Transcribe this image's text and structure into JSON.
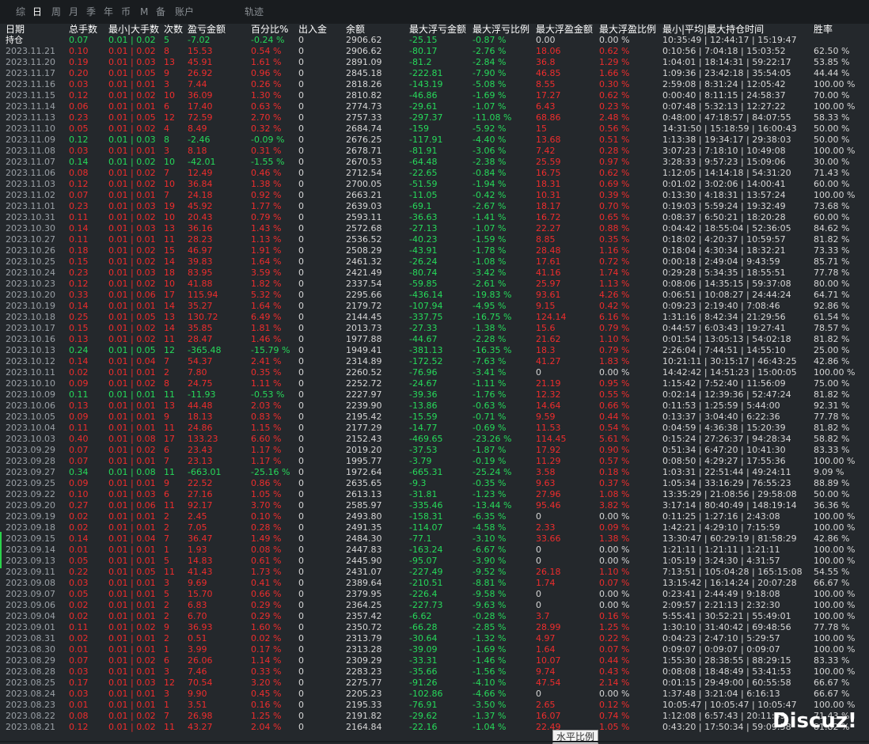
{
  "toolbar": {
    "tabs": [
      "综",
      "日",
      "周",
      "月",
      "季",
      "年",
      "币",
      "M",
      "备",
      "账户",
      "轨迹"
    ],
    "active_tab": "日"
  },
  "table": {
    "headers": [
      "日期",
      "总手数",
      "最小|大手数",
      "次数",
      "盈亏金额",
      "百分比%",
      "出入金",
      "余额",
      "最大浮亏金额",
      "最大浮亏比例",
      "最大浮盈金额",
      "最大浮盈比例",
      "最小|平均|最大持仓时间",
      "胜率"
    ],
    "rows": [
      [
        "持仓",
        "0.07",
        "0.01 | 0.02",
        "5",
        "-7.02",
        "-0.24 %",
        "0",
        "2906.62",
        "-25.15",
        "-0.87 %",
        "0.00",
        "0.00 %",
        "10:35:49 | 12:44:17 | 15:19:47",
        ""
      ],
      [
        "2023.11.21",
        "0.10",
        "0.01 | 0.02",
        "8",
        "15.53",
        "0.54 %",
        "0",
        "2906.62",
        "-80.17",
        "-2.76 %",
        "18.06",
        "0.62 %",
        "0:10:56 | 7:04:18 | 15:03:52",
        "62.50 %"
      ],
      [
        "2023.11.20",
        "0.19",
        "0.01 | 0.03",
        "13",
        "45.91",
        "1.61 %",
        "0",
        "2891.09",
        "-81.2",
        "-2.84 %",
        "36.8",
        "1.29 %",
        "1:04:01 | 18:14:31 | 59:22:17",
        "53.85 %"
      ],
      [
        "2023.11.17",
        "0.20",
        "0.01 | 0.05",
        "9",
        "26.92",
        "0.96 %",
        "0",
        "2845.18",
        "-222.81",
        "-7.90 %",
        "46.85",
        "1.66 %",
        "1:09:36 | 23:42:18 | 35:54:05",
        "44.44 %"
      ],
      [
        "2023.11.16",
        "0.03",
        "0.01 | 0.01",
        "3",
        "7.44",
        "0.26 %",
        "0",
        "2818.26",
        "-143.19",
        "-5.08 %",
        "8.55",
        "0.30 %",
        "2:59:08 | 8:31:24 | 12:05:42",
        "100.00 %"
      ],
      [
        "2023.11.15",
        "0.12",
        "0.01 | 0.02",
        "10",
        "36.09",
        "1.30 %",
        "0",
        "2810.82",
        "-46.86",
        "-1.69 %",
        "17.27",
        "0.62 %",
        "0:00:40 | 8:11:15 | 24:58:37",
        "70.00 %"
      ],
      [
        "2023.11.14",
        "0.06",
        "0.01 | 0.01",
        "6",
        "17.40",
        "0.63 %",
        "0",
        "2774.73",
        "-29.61",
        "-1.07 %",
        "6.43",
        "0.23 %",
        "0:07:48 | 5:32:13 | 12:27:22",
        "100.00 %"
      ],
      [
        "2023.11.13",
        "0.23",
        "0.01 | 0.05",
        "12",
        "72.59",
        "2.70 %",
        "0",
        "2757.33",
        "-297.37",
        "-11.08 %",
        "68.86",
        "2.48 %",
        "0:48:00 | 47:18:57 | 84:07:55",
        "58.33 %"
      ],
      [
        "2023.11.10",
        "0.05",
        "0.01 | 0.02",
        "4",
        "8.49",
        "0.32 %",
        "0",
        "2684.74",
        "-159",
        "-5.92 %",
        "15",
        "0.56 %",
        "14:31:50 | 15:18:59 | 16:00:43",
        "50.00 %"
      ],
      [
        "2023.11.09",
        "0.12",
        "0.01 | 0.03",
        "8",
        "-2.46",
        "-0.09 %",
        "0",
        "2676.25",
        "-117.91",
        "-4.40 %",
        "13.68",
        "0.51 %",
        "1:13:38 | 19:34:17 | 29:38:03",
        "50.00 %"
      ],
      [
        "2023.11.08",
        "0.03",
        "0.01 | 0.01",
        "3",
        "8.18",
        "0.31 %",
        "0",
        "2678.71",
        "-81.91",
        "-3.06 %",
        "7.42",
        "0.28 %",
        "3:07:23 | 7:18:10 | 10:49:08",
        "100.00 %"
      ],
      [
        "2023.11.07",
        "0.14",
        "0.01 | 0.02",
        "10",
        "-42.01",
        "-1.55 %",
        "0",
        "2670.53",
        "-64.48",
        "-2.38 %",
        "25.59",
        "0.97 %",
        "3:28:33 | 9:57:23 | 15:09:06",
        "30.00 %"
      ],
      [
        "2023.11.06",
        "0.08",
        "0.01 | 0.02",
        "7",
        "12.49",
        "0.46 %",
        "0",
        "2712.54",
        "-22.65",
        "-0.84 %",
        "16.75",
        "0.62 %",
        "1:12:05 | 14:14:18 | 54:31:20",
        "71.43 %"
      ],
      [
        "2023.11.03",
        "0.12",
        "0.01 | 0.02",
        "10",
        "36.84",
        "1.38 %",
        "0",
        "2700.05",
        "-51.59",
        "-1.94 %",
        "18.31",
        "0.69 %",
        "0:01:02 | 3:02:06 | 14:00:41",
        "60.00 %"
      ],
      [
        "2023.11.02",
        "0.07",
        "0.01 | 0.01",
        "7",
        "24.18",
        "0.92 %",
        "0",
        "2663.21",
        "-11.05",
        "-0.42 %",
        "10.31",
        "0.39 %",
        "0:13:30 | 4:18:31 | 13:57:24",
        "100.00 %"
      ],
      [
        "2023.11.01",
        "0.23",
        "0.01 | 0.03",
        "19",
        "45.92",
        "1.77 %",
        "0",
        "2639.03",
        "-69.1",
        "-2.67 %",
        "18.17",
        "0.70 %",
        "0:19:03 | 5:59:24 | 19:32:49",
        "73.68 %"
      ],
      [
        "2023.10.31",
        "0.11",
        "0.01 | 0.02",
        "10",
        "20.43",
        "0.79 %",
        "0",
        "2593.11",
        "-36.63",
        "-1.41 %",
        "16.72",
        "0.65 %",
        "0:08:37 | 6:50:21 | 18:20:28",
        "60.00 %"
      ],
      [
        "2023.10.30",
        "0.14",
        "0.01 | 0.03",
        "13",
        "36.16",
        "1.43 %",
        "0",
        "2572.68",
        "-27.13",
        "-1.07 %",
        "22.27",
        "0.88 %",
        "0:04:42 | 18:55:04 | 52:36:05",
        "84.62 %"
      ],
      [
        "2023.10.27",
        "0.11",
        "0.01 | 0.01",
        "11",
        "28.23",
        "1.13 %",
        "0",
        "2536.52",
        "-40.23",
        "-1.59 %",
        "8.85",
        "0.35 %",
        "0:18:02 | 4:20:37 | 10:59:57",
        "81.82 %"
      ],
      [
        "2023.10.26",
        "0.18",
        "0.01 | 0.02",
        "15",
        "46.97",
        "1.91 %",
        "0",
        "2508.29",
        "-43.91",
        "-1.78 %",
        "28.48",
        "1.16 %",
        "0:18:04 | 4:30:34 | 18:32:21",
        "73.33 %"
      ],
      [
        "2023.10.25",
        "0.15",
        "0.01 | 0.02",
        "14",
        "39.83",
        "1.64 %",
        "0",
        "2461.32",
        "-26.24",
        "-1.08 %",
        "17.61",
        "0.72 %",
        "0:00:18 | 2:49:04 | 9:43:59",
        "85.71 %"
      ],
      [
        "2023.10.24",
        "0.23",
        "0.01 | 0.03",
        "18",
        "83.95",
        "3.59 %",
        "0",
        "2421.49",
        "-80.74",
        "-3.42 %",
        "41.16",
        "1.74 %",
        "0:29:28 | 5:34:35 | 18:55:51",
        "77.78 %"
      ],
      [
        "2023.10.23",
        "0.12",
        "0.01 | 0.02",
        "10",
        "41.88",
        "1.82 %",
        "0",
        "2337.54",
        "-59.85",
        "-2.61 %",
        "25.97",
        "1.13 %",
        "0:08:06 | 14:35:15 | 59:37:08",
        "80.00 %"
      ],
      [
        "2023.10.20",
        "0.33",
        "0.01 | 0.06",
        "17",
        "115.94",
        "5.32 %",
        "0",
        "2295.66",
        "-436.14",
        "-19.83 %",
        "93.61",
        "4.26 %",
        "0:06:51 | 10:08:27 | 24:44:24",
        "64.71 %"
      ],
      [
        "2023.10.19",
        "0.14",
        "0.01 | 0.01",
        "14",
        "35.27",
        "1.64 %",
        "0",
        "2179.72",
        "-107.94",
        "-4.95 %",
        "9.15",
        "0.42 %",
        "0:09:23 | 2:19:40 | 7:08:46",
        "92.86 %"
      ],
      [
        "2023.10.18",
        "0.25",
        "0.01 | 0.05",
        "13",
        "130.72",
        "6.49 %",
        "0",
        "2144.45",
        "-337.75",
        "-16.75 %",
        "124.14",
        "6.16 %",
        "1:31:16 | 8:42:34 | 21:29:56",
        "61.54 %"
      ],
      [
        "2023.10.17",
        "0.15",
        "0.01 | 0.02",
        "14",
        "35.85",
        "1.81 %",
        "0",
        "2013.73",
        "-27.33",
        "-1.38 %",
        "15.6",
        "0.79 %",
        "0:44:57 | 6:03:43 | 19:27:41",
        "78.57 %"
      ],
      [
        "2023.10.16",
        "0.13",
        "0.01 | 0.02",
        "11",
        "28.47",
        "1.46 %",
        "0",
        "1977.88",
        "-44.67",
        "-2.28 %",
        "21.62",
        "1.10 %",
        "0:01:54 | 13:05:13 | 54:02:18",
        "81.82 %"
      ],
      [
        "2023.10.13",
        "0.24",
        "0.01 | 0.05",
        "12",
        "-365.48",
        "-15.79 %",
        "0",
        "1949.41",
        "-381.13",
        "-16.35 %",
        "18.3",
        "0.79 %",
        "2:26:04 | 7:44:51 | 14:55:10",
        "25.00 %"
      ],
      [
        "2023.10.12",
        "0.14",
        "0.01 | 0.04",
        "7",
        "54.37",
        "2.41 %",
        "0",
        "2314.89",
        "-172.52",
        "-7.63 %",
        "41.27",
        "1.83 %",
        "10:21:11 | 30:15:17 | 46:43:25",
        "42.86 %"
      ],
      [
        "2023.10.11",
        "0.02",
        "0.01 | 0.01",
        "2",
        "7.80",
        "0.35 %",
        "0",
        "2260.52",
        "-76.96",
        "-3.41 %",
        "0",
        "0.00 %",
        "14:42:42 | 14:51:23 | 15:00:05",
        "100.00 %"
      ],
      [
        "2023.10.10",
        "0.09",
        "0.01 | 0.02",
        "8",
        "24.75",
        "1.11 %",
        "0",
        "2252.72",
        "-24.67",
        "-1.11 %",
        "21.19",
        "0.95 %",
        "1:15:42 | 7:52:40 | 11:56:09",
        "75.00 %"
      ],
      [
        "2023.10.09",
        "0.11",
        "0.01 | 0.01",
        "11",
        "-11.93",
        "-0.53 %",
        "0",
        "2227.97",
        "-39.36",
        "-1.76 %",
        "12.32",
        "0.55 %",
        "0:02:14 | 12:39:36 | 52:47:24",
        "81.82 %"
      ],
      [
        "2023.10.06",
        "0.13",
        "0.01 | 0.01",
        "13",
        "44.48",
        "2.03 %",
        "0",
        "2239.90",
        "-13.86",
        "-0.63 %",
        "14.64",
        "0.66 %",
        "0:11:53 | 1:25:59 | 5:44:00",
        "92.31 %"
      ],
      [
        "2023.10.05",
        "0.09",
        "0.01 | 0.01",
        "9",
        "18.13",
        "0.83 %",
        "0",
        "2195.42",
        "-15.59",
        "-0.71 %",
        "9.59",
        "0.44 %",
        "0:13:37 | 3:04:40 | 6:22:36",
        "77.78 %"
      ],
      [
        "2023.10.04",
        "0.11",
        "0.01 | 0.01",
        "11",
        "24.86",
        "1.15 %",
        "0",
        "2177.29",
        "-14.77",
        "-0.69 %",
        "11.53",
        "0.54 %",
        "0:04:59 | 4:36:38 | 15:20:39",
        "81.82 %"
      ],
      [
        "2023.10.03",
        "0.40",
        "0.01 | 0.08",
        "17",
        "133.23",
        "6.60 %",
        "0",
        "2152.43",
        "-469.65",
        "-23.26 %",
        "114.45",
        "5.61 %",
        "0:15:24 | 27:26:37 | 94:28:34",
        "58.82 %"
      ],
      [
        "2023.09.29",
        "0.07",
        "0.01 | 0.02",
        "6",
        "23.43",
        "1.17 %",
        "0",
        "2019.20",
        "-37.53",
        "-1.87 %",
        "17.92",
        "0.90 %",
        "0:51:34 | 6:47:20 | 10:41:30",
        "83.33 %"
      ],
      [
        "2023.09.28",
        "0.07",
        "0.01 | 0.01",
        "7",
        "23.13",
        "1.17 %",
        "0",
        "1995.77",
        "-3.79",
        "-0.19 %",
        "11.29",
        "0.57 %",
        "0:08:50 | 4:29:27 | 17:55:36",
        "100.00 %"
      ],
      [
        "2023.09.27",
        "0.34",
        "0.01 | 0.08",
        "11",
        "-663.01",
        "-25.16 %",
        "0",
        "1972.64",
        "-665.31",
        "-25.24 %",
        "3.58",
        "0.18 %",
        "1:03:31 | 22:51:44 | 49:24:11",
        "9.09 %"
      ],
      [
        "2023.09.25",
        "0.09",
        "0.01 | 0.01",
        "9",
        "22.52",
        "0.86 %",
        "0",
        "2635.65",
        "-9.3",
        "-0.35 %",
        "9.63",
        "0.37 %",
        "1:05:34 | 33:16:29 | 76:55:23",
        "88.89 %"
      ],
      [
        "2023.09.22",
        "0.10",
        "0.01 | 0.03",
        "6",
        "27.16",
        "1.05 %",
        "0",
        "2613.13",
        "-31.81",
        "-1.23 %",
        "27.96",
        "1.08 %",
        "13:35:29 | 21:08:56 | 29:58:08",
        "50.00 %"
      ],
      [
        "2023.09.20",
        "0.27",
        "0.01 | 0.06",
        "11",
        "92.17",
        "3.70 %",
        "0",
        "2585.97",
        "-335.46",
        "-13.44 %",
        "95.46",
        "3.82 %",
        "3:17:14 | 80:40:49 | 148:19:14",
        "36.36 %"
      ],
      [
        "2023.09.19",
        "0.02",
        "0.01 | 0.01",
        "2",
        "2.45",
        "0.10 %",
        "0",
        "2493.80",
        "-158.31",
        "-6.35 %",
        "0",
        "0.00 %",
        "0:11:25 | 1:27:16 | 2:43:08",
        "100.00 %"
      ],
      [
        "2023.09.18",
        "0.02",
        "0.01 | 0.01",
        "2",
        "7.05",
        "0.28 %",
        "0",
        "2491.35",
        "-114.07",
        "-4.58 %",
        "2.33",
        "0.09 %",
        "1:42:21 | 4:29:10 | 7:15:59",
        "100.00 %"
      ],
      [
        "2023.09.15",
        "0.14",
        "0.01 | 0.04",
        "7",
        "36.47",
        "1.49 %",
        "0",
        "2484.30",
        "-77.1",
        "-3.10 %",
        "33.66",
        "1.38 %",
        "13:30:47 | 60:29:19 | 81:58:29",
        "42.86 %"
      ],
      [
        "2023.09.14",
        "0.01",
        "0.01 | 0.01",
        "1",
        "1.93",
        "0.08 %",
        "0",
        "2447.83",
        "-163.24",
        "-6.67 %",
        "0",
        "0.00 %",
        "1:21:11 | 1:21:11 | 1:21:11",
        "100.00 %"
      ],
      [
        "2023.09.13",
        "0.05",
        "0.01 | 0.01",
        "5",
        "14.83",
        "0.61 %",
        "0",
        "2445.90",
        "-95.07",
        "-3.90 %",
        "0",
        "0.00 %",
        "1:05:19 | 3:24:30 | 4:31:57",
        "100.00 %"
      ],
      [
        "2023.09.11",
        "0.22",
        "0.01 | 0.05",
        "11",
        "41.43",
        "1.73 %",
        "0",
        "2431.07",
        "-227.49",
        "-9.52 %",
        "26.18",
        "1.10 %",
        "7:13:51 | 105:04:28 | 165:15:08",
        "54.55 %"
      ],
      [
        "2023.09.08",
        "0.03",
        "0.01 | 0.01",
        "3",
        "9.69",
        "0.41 %",
        "0",
        "2389.64",
        "-210.51",
        "-8.81 %",
        "1.74",
        "0.07 %",
        "13:15:42 | 16:14:24 | 20:07:28",
        "66.67 %"
      ],
      [
        "2023.09.07",
        "0.05",
        "0.01 | 0.01",
        "5",
        "15.70",
        "0.66 %",
        "0",
        "2379.95",
        "-226.4",
        "-9.58 %",
        "0",
        "0.00 %",
        "0:23:41 | 2:44:49 | 9:18:08",
        "100.00 %"
      ],
      [
        "2023.09.06",
        "0.02",
        "0.01 | 0.01",
        "2",
        "6.83",
        "0.29 %",
        "0",
        "2364.25",
        "-227.73",
        "-9.63 %",
        "0",
        "0.00 %",
        "2:09:57 | 2:21:13 | 2:32:30",
        "100.00 %"
      ],
      [
        "2023.09.04",
        "0.02",
        "0.01 | 0.01",
        "2",
        "6.70",
        "0.29 %",
        "0",
        "2357.42",
        "-6.62",
        "-0.28 %",
        "3.7",
        "0.16 %",
        "5:55:41 | 30:52:21 | 55:49:01",
        "100.00 %"
      ],
      [
        "2023.09.01",
        "0.11",
        "0.01 | 0.02",
        "9",
        "36.93",
        "1.60 %",
        "0",
        "2350.72",
        "-66.28",
        "-2.85 %",
        "28.99",
        "1.25 %",
        "1:30:10 | 31:40:42 | 69:48:56",
        "77.78 %"
      ],
      [
        "2023.08.31",
        "0.02",
        "0.01 | 0.01",
        "2",
        "0.51",
        "0.02 %",
        "0",
        "2313.79",
        "-30.64",
        "-1.32 %",
        "4.97",
        "0.22 %",
        "0:04:23 | 2:47:10 | 5:29:57",
        "100.00 %"
      ],
      [
        "2023.08.30",
        "0.01",
        "0.01 | 0.01",
        "1",
        "3.99",
        "0.17 %",
        "0",
        "2313.28",
        "-39.09",
        "-1.69 %",
        "1.64",
        "0.07 %",
        "0:09:07 | 0:09:07 | 0:09:07",
        "100.00 %"
      ],
      [
        "2023.08.29",
        "0.07",
        "0.01 | 0.02",
        "6",
        "26.06",
        "1.14 %",
        "0",
        "2309.29",
        "-33.31",
        "-1.46 %",
        "10.07",
        "0.44 %",
        "1:55:30 | 28:38:55 | 88:29:15",
        "83.33 %"
      ],
      [
        "2023.08.28",
        "0.03",
        "0.01 | 0.01",
        "3",
        "7.46",
        "0.33 %",
        "0",
        "2283.23",
        "-35.66",
        "-1.56 %",
        "9.74",
        "0.43 %",
        "0:08:08 | 18:48:49 | 53:41:53",
        "100.00 %"
      ],
      [
        "2023.08.25",
        "0.17",
        "0.01 | 0.03",
        "12",
        "70.54",
        "3.20 %",
        "0",
        "2275.77",
        "-91.26",
        "-4.10 %",
        "47.54",
        "2.14 %",
        "0:01:15 | 29:49:00 | 60:55:58",
        "66.67 %"
      ],
      [
        "2023.08.24",
        "0.03",
        "0.01 | 0.01",
        "3",
        "9.90",
        "0.45 %",
        "0",
        "2205.23",
        "-102.86",
        "-4.66 %",
        "0",
        "0.00 %",
        "1:37:48 | 3:21:04 | 6:16:13",
        "66.67 %"
      ],
      [
        "2023.08.23",
        "0.01",
        "0.01 | 0.01",
        "1",
        "3.51",
        "0.16 %",
        "0",
        "2195.33",
        "-76.91",
        "-3.50 %",
        "2.65",
        "0.12 %",
        "10:05:47 | 10:05:47 | 10:05:47",
        "100.00 %"
      ],
      [
        "2023.08.22",
        "0.08",
        "0.01 | 0.02",
        "7",
        "26.98",
        "1.25 %",
        "0",
        "2191.82",
        "-29.62",
        "-1.37 %",
        "16.07",
        "0.74 %",
        "1:12:08 | 6:57:43 | 20:11:49",
        "71.43 %"
      ],
      [
        "2023.08.21",
        "0.12",
        "0.01 | 0.02",
        "11",
        "43.27",
        "2.04 %",
        "0",
        "2164.84",
        "-22.16",
        "-1.04 %",
        "22.49",
        "1.05 %",
        "0:43:20 | 17:50:34 | 59:09:58",
        "81.82 %"
      ]
    ]
  },
  "tooltip": {
    "text": "水平比例"
  },
  "watermark": {
    "text": "Discuz!"
  },
  "colors": {
    "profit": "#ee2d2d",
    "loss": "#26d95a",
    "header": "#ffffff",
    "neutral": "#d6d6d6",
    "background": "#24282c"
  }
}
